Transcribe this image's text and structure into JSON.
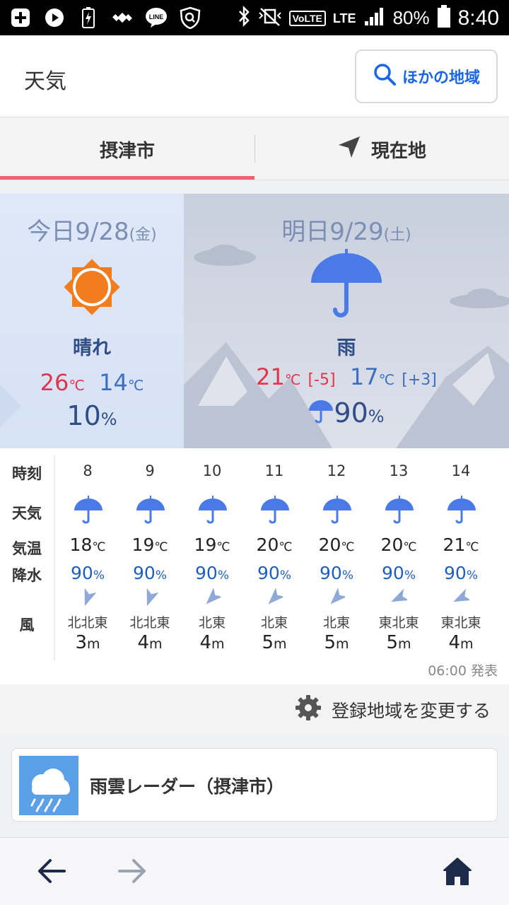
{
  "status_bar": {
    "network": "LTE",
    "battery_percent": "80%",
    "time": "8:40",
    "volte": "VoLTE"
  },
  "header": {
    "title": "天気",
    "other_regions_label": "ほかの地域"
  },
  "tabs": [
    {
      "label": "摂津市",
      "selected": true
    },
    {
      "label": "現在地",
      "selected": false
    }
  ],
  "today": {
    "date": "今日9/28",
    "weekday": "(金)",
    "condition": "晴れ",
    "high": "26",
    "low": "14",
    "temp_unit": "℃",
    "precip": "10",
    "precip_unit": "%"
  },
  "tomorrow": {
    "date": "明日9/29",
    "weekday": "(土)",
    "condition": "雨",
    "high": "21",
    "high_diff": "[-5]",
    "low": "17",
    "low_diff": "[+3]",
    "temp_unit": "℃",
    "precip": "90",
    "precip_unit": "%"
  },
  "hourly": {
    "labels": {
      "time": "時刻",
      "weather": "天気",
      "temp": "気温",
      "rain": "降水",
      "wind": "風"
    },
    "temp_unit": "℃",
    "rain_unit": "%",
    "speed_unit": "m",
    "columns": [
      {
        "time": "8",
        "temp": "18",
        "rain": "90",
        "dir": "北北東",
        "speed": "3"
      },
      {
        "time": "9",
        "temp": "19",
        "rain": "90",
        "dir": "北北東",
        "speed": "4"
      },
      {
        "time": "10",
        "temp": "19",
        "rain": "90",
        "dir": "北東",
        "speed": "4"
      },
      {
        "time": "11",
        "temp": "20",
        "rain": "90",
        "dir": "北東",
        "speed": "5"
      },
      {
        "time": "12",
        "temp": "20",
        "rain": "90",
        "dir": "北東",
        "speed": "5"
      },
      {
        "time": "13",
        "temp": "20",
        "rain": "90",
        "dir": "東北東",
        "speed": "5"
      },
      {
        "time": "14",
        "temp": "21",
        "rain": "90",
        "dir": "東北東",
        "speed": "4"
      }
    ],
    "issued": "06:00 発表"
  },
  "change_region_label": "登録地域を変更する",
  "radar_label": "雨雲レーダー（摂津市）",
  "colors": {
    "accent_blue": "#1a66e6",
    "tab_underline": "#f06070",
    "umbrella": "#4a7ae8",
    "sun": "#f27d1e"
  }
}
